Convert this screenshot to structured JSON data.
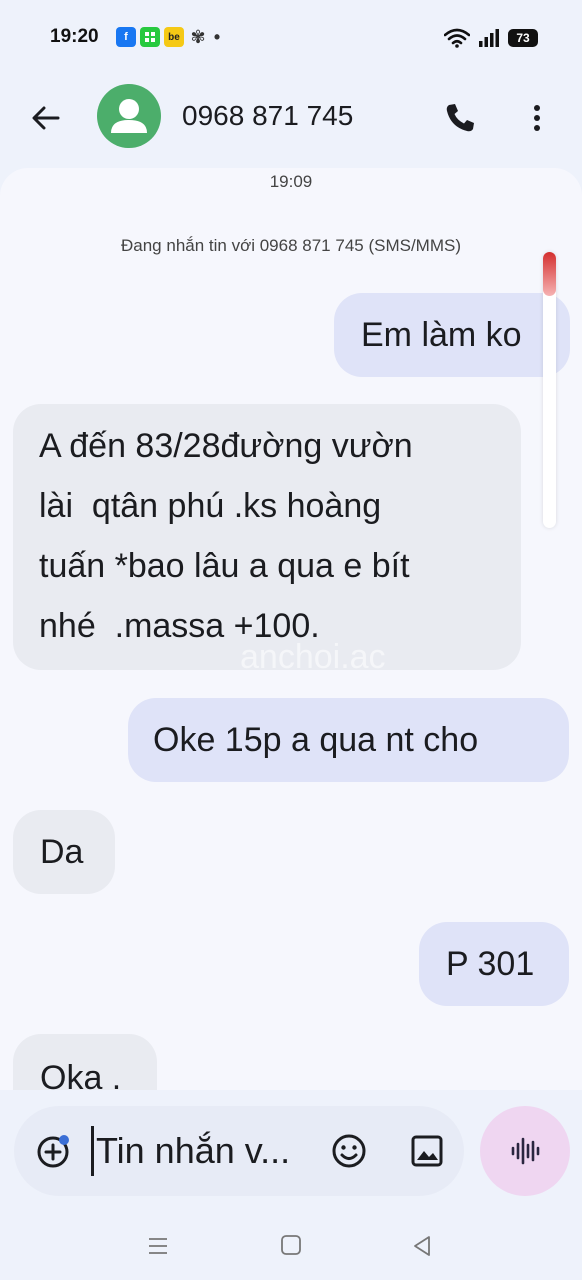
{
  "status_bar": {
    "time": "19:20",
    "battery": "73",
    "notification_icons": [
      "facebook-icon",
      "grid-app-icon",
      "be-app-icon",
      "pinwheel-icon",
      "dot-icon"
    ],
    "notif_labels": {
      "fb": "f",
      "be": "be"
    }
  },
  "header": {
    "title": "0968 871 745"
  },
  "conversation": {
    "timestamp": "19:09",
    "info": "Đang nhắn tin với 0968 871 745 (SMS/MMS)",
    "messages": [
      {
        "direction": "out",
        "lines": [
          "Em làm ko"
        ]
      },
      {
        "direction": "in",
        "lines": [
          "A đến 83/28đường vườn",
          "lài  qtân phú .ks hoàng",
          "tuấn *bao lâu a qua e bít",
          "nhé  .massa +100."
        ]
      },
      {
        "direction": "out",
        "lines": [
          "Oke 15p a qua nt cho"
        ]
      },
      {
        "direction": "in",
        "lines": [
          "Da"
        ]
      },
      {
        "direction": "out",
        "lines": [
          "P 301"
        ]
      },
      {
        "direction": "in",
        "lines": [
          "Oka ."
        ]
      }
    ],
    "watermark": "anchoi.ac"
  },
  "compose": {
    "placeholder": "Tin nhắn v..."
  },
  "colors": {
    "background": "#eef2fb",
    "chat_background": "#f6f7fd",
    "outgoing_bubble": "#dfe3f8",
    "incoming_bubble": "#e9ebf1",
    "avatar": "#4cae6b",
    "voice_button": "#efd6f1",
    "scroll_thumb": "#d32f2f"
  }
}
